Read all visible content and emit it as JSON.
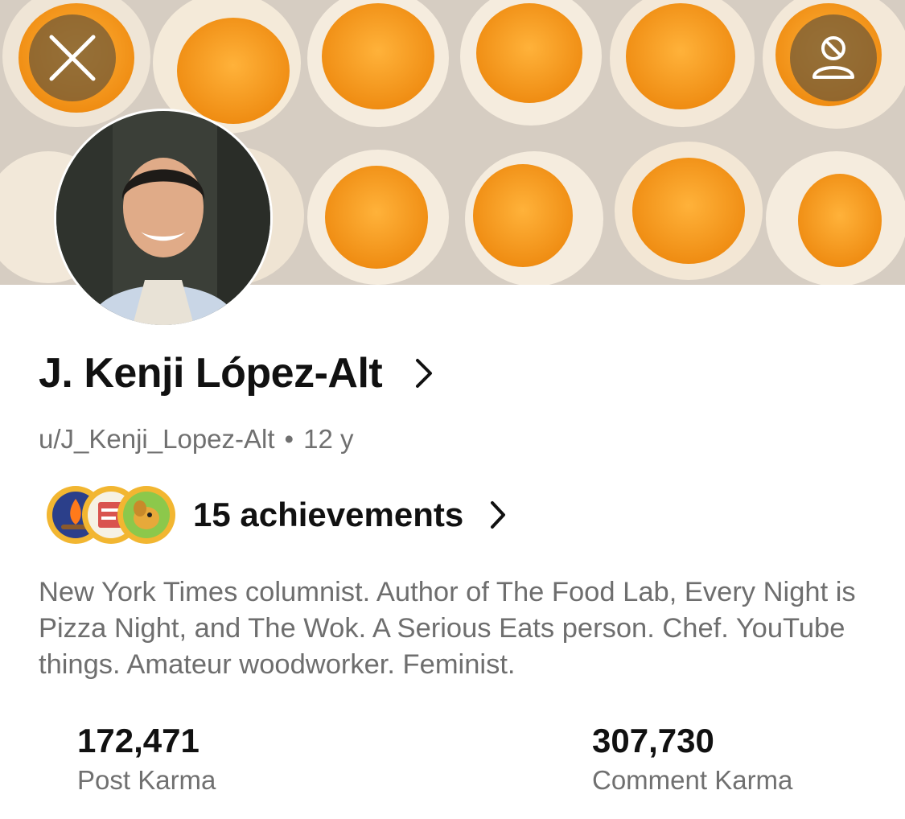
{
  "header": {
    "banner": "egg-carton-banner",
    "close_icon": "close-icon",
    "profile_icon": "user-blocked-icon"
  },
  "profile": {
    "display_name": "J. Kenji López-Alt",
    "username": "u/J_Kenji_Lopez-Alt",
    "separator": "•",
    "account_age": "12 y",
    "achievements_label": "15 achievements",
    "bio": "New York Times columnist. Author of The Food Lab, Every Night is Pizza Night, and The Wok. A Serious Eats person. Chef. YouTube things. Amateur woodworker. Feminist."
  },
  "stats": [
    {
      "value": "172,471",
      "label": "Post Karma"
    },
    {
      "value": "307,730",
      "label": "Comment Karma"
    }
  ],
  "colors": {
    "yolk": "#f39a1e",
    "egg_white": "#fbf3e4",
    "carton": "#d9d0c6",
    "button_overlay": "#6e5837"
  }
}
